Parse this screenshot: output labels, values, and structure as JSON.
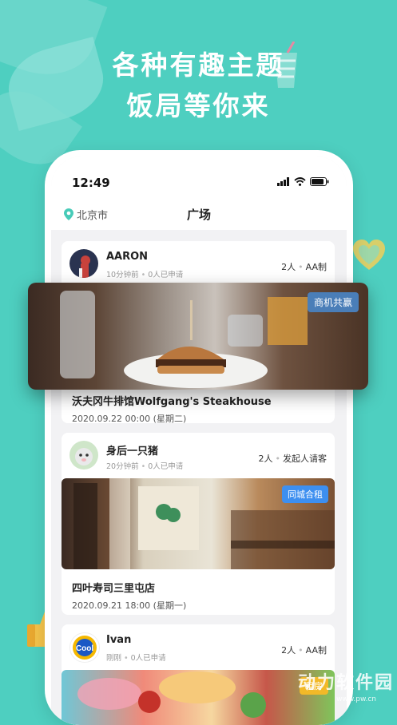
{
  "hero": {
    "line1": "各种有趣主题",
    "line2": "饭局等你来"
  },
  "status_bar": {
    "time": "12:49"
  },
  "navbar": {
    "location": "北京市",
    "title": "广场"
  },
  "posts": [
    {
      "username": "AARON",
      "time_ago": "10分钟前",
      "applied": "0人已申请",
      "people": "2人",
      "pay": "AA制",
      "badge": "商机共赢",
      "badge_color": "#4a7eb8",
      "title": "沃夫冈牛排馆Wolfgang's Steakhouse",
      "date": "2020.09.22 00:00 (星期二)"
    },
    {
      "username": "身后一只猪",
      "time_ago": "20分钟前",
      "applied": "0人已申请",
      "people": "2人",
      "pay": "发起人请客",
      "badge": "同城合租",
      "badge_color": "#3d8ff0",
      "title": "四叶寿司三里屯店",
      "date": "2020.09.21 18:00 (星期一)"
    },
    {
      "username": "Ivan",
      "time_ago": "刚刚",
      "applied": "0人已申请",
      "people": "2人",
      "pay": "AA制",
      "badge": "租房"
    }
  ],
  "watermark": {
    "text": "动力软件园",
    "url": "www.pw.cn"
  },
  "colors": {
    "background": "#4ecfc0",
    "card": "#ffffff"
  }
}
